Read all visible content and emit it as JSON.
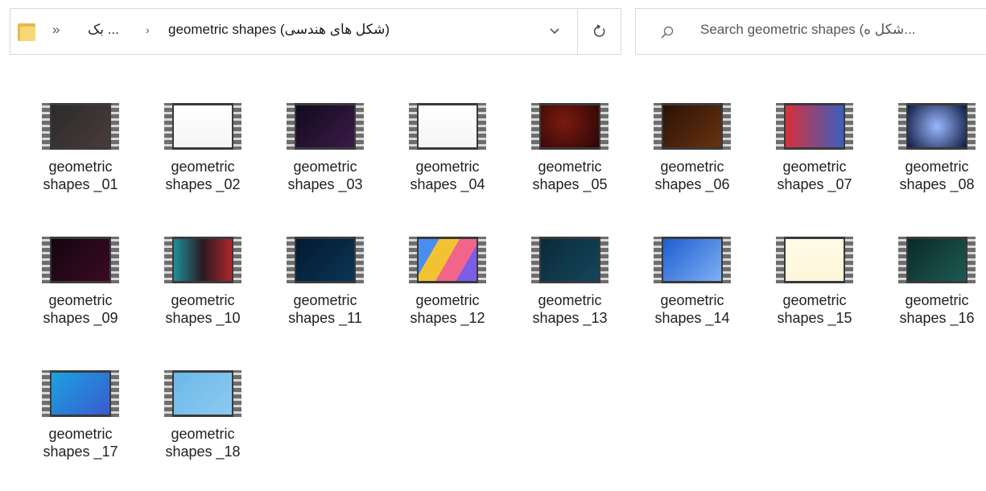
{
  "address": {
    "overflow": "»",
    "parent": "... بک",
    "separator": "›",
    "current": "geometric shapes (شکل های هندسی)"
  },
  "search": {
    "placeholder": "Search geometric shapes (شکل ه..."
  },
  "icons": {
    "folder": "folder-icon",
    "dropdown": "chevron-down-icon",
    "refresh": "refresh-icon",
    "search": "search-icon",
    "video": "video-file-icon"
  },
  "files": [
    {
      "name": "geometric\nshapes _01",
      "thumb": "linear-gradient(135deg,#2b2b2b,#4a3b3b)"
    },
    {
      "name": "geometric\nshapes _02",
      "thumb": "linear-gradient(#ffffff,#f5f5f5)"
    },
    {
      "name": "geometric\nshapes _03",
      "thumb": "linear-gradient(135deg,#120a1c,#3a1a4a)"
    },
    {
      "name": "geometric\nshapes _04",
      "thumb": "linear-gradient(#ffffff,#f5f5f5)"
    },
    {
      "name": "geometric\nshapes _05",
      "thumb": "radial-gradient(circle at 40% 40%,#7a1a10,#2b0605)"
    },
    {
      "name": "geometric\nshapes _06",
      "thumb": "linear-gradient(135deg,#2a1205,#6a3310)"
    },
    {
      "name": "geometric\nshapes _07",
      "thumb": "linear-gradient(90deg,#d8303a,#3a5fc0)"
    },
    {
      "name": "geometric\nshapes _08",
      "thumb": "radial-gradient(circle,#9ab8ff,#0e1a40)"
    },
    {
      "name": "geometric\nshapes _09",
      "thumb": "linear-gradient(135deg,#140510,#3b0a22)"
    },
    {
      "name": "geometric\nshapes _10",
      "thumb": "linear-gradient(90deg,#1f8f9a,#2a1a22 50%,#b0262e)"
    },
    {
      "name": "geometric\nshapes _11",
      "thumb": "linear-gradient(135deg,#031a30,#0a3556)"
    },
    {
      "name": "geometric\nshapes _12",
      "thumb": "linear-gradient(120deg,#4a8df0 0 25%,#f3c233 25% 50%,#f2658a 50% 75%,#7b5de6 75%)"
    },
    {
      "name": "geometric\nshapes _13",
      "thumb": "linear-gradient(135deg,#0b2a3a,#15465c)"
    },
    {
      "name": "geometric\nshapes _14",
      "thumb": "linear-gradient(135deg,#1d5fd0,#7fb0f5)"
    },
    {
      "name": "geometric\nshapes _15",
      "thumb": "linear-gradient(#fffbe6,#fdf6da)"
    },
    {
      "name": "geometric\nshapes _16",
      "thumb": "linear-gradient(135deg,#0b2a28,#1d5a52)"
    },
    {
      "name": "geometric\nshapes _17",
      "thumb": "linear-gradient(135deg,#1aa3e0,#3a5ad0)"
    },
    {
      "name": "geometric\nshapes _18",
      "thumb": "linear-gradient(135deg,#6ab8ea,#8ec9f0)"
    }
  ]
}
